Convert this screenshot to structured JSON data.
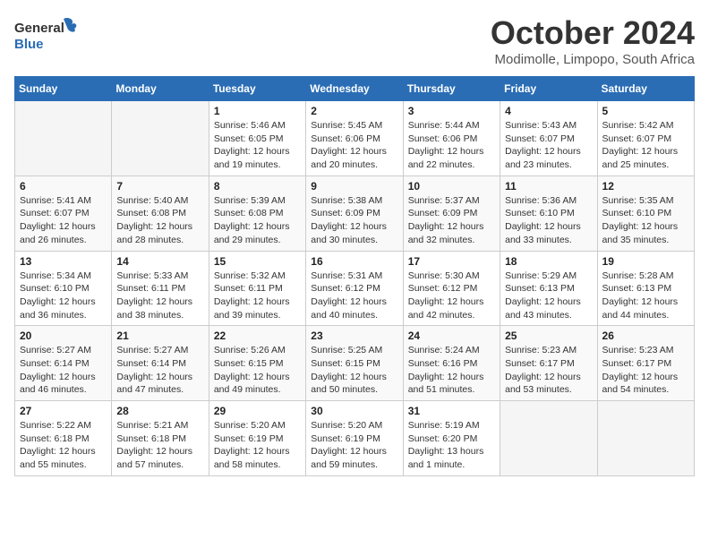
{
  "header": {
    "logo_general": "General",
    "logo_blue": "Blue",
    "month_title": "October 2024",
    "location": "Modimolle, Limpopo, South Africa"
  },
  "weekdays": [
    "Sunday",
    "Monday",
    "Tuesday",
    "Wednesday",
    "Thursday",
    "Friday",
    "Saturday"
  ],
  "weeks": [
    [
      {
        "day": "",
        "info": ""
      },
      {
        "day": "",
        "info": ""
      },
      {
        "day": "1",
        "info": "Sunrise: 5:46 AM\nSunset: 6:05 PM\nDaylight: 12 hours and 19 minutes."
      },
      {
        "day": "2",
        "info": "Sunrise: 5:45 AM\nSunset: 6:06 PM\nDaylight: 12 hours and 20 minutes."
      },
      {
        "day": "3",
        "info": "Sunrise: 5:44 AM\nSunset: 6:06 PM\nDaylight: 12 hours and 22 minutes."
      },
      {
        "day": "4",
        "info": "Sunrise: 5:43 AM\nSunset: 6:07 PM\nDaylight: 12 hours and 23 minutes."
      },
      {
        "day": "5",
        "info": "Sunrise: 5:42 AM\nSunset: 6:07 PM\nDaylight: 12 hours and 25 minutes."
      }
    ],
    [
      {
        "day": "6",
        "info": "Sunrise: 5:41 AM\nSunset: 6:07 PM\nDaylight: 12 hours and 26 minutes."
      },
      {
        "day": "7",
        "info": "Sunrise: 5:40 AM\nSunset: 6:08 PM\nDaylight: 12 hours and 28 minutes."
      },
      {
        "day": "8",
        "info": "Sunrise: 5:39 AM\nSunset: 6:08 PM\nDaylight: 12 hours and 29 minutes."
      },
      {
        "day": "9",
        "info": "Sunrise: 5:38 AM\nSunset: 6:09 PM\nDaylight: 12 hours and 30 minutes."
      },
      {
        "day": "10",
        "info": "Sunrise: 5:37 AM\nSunset: 6:09 PM\nDaylight: 12 hours and 32 minutes."
      },
      {
        "day": "11",
        "info": "Sunrise: 5:36 AM\nSunset: 6:10 PM\nDaylight: 12 hours and 33 minutes."
      },
      {
        "day": "12",
        "info": "Sunrise: 5:35 AM\nSunset: 6:10 PM\nDaylight: 12 hours and 35 minutes."
      }
    ],
    [
      {
        "day": "13",
        "info": "Sunrise: 5:34 AM\nSunset: 6:10 PM\nDaylight: 12 hours and 36 minutes."
      },
      {
        "day": "14",
        "info": "Sunrise: 5:33 AM\nSunset: 6:11 PM\nDaylight: 12 hours and 38 minutes."
      },
      {
        "day": "15",
        "info": "Sunrise: 5:32 AM\nSunset: 6:11 PM\nDaylight: 12 hours and 39 minutes."
      },
      {
        "day": "16",
        "info": "Sunrise: 5:31 AM\nSunset: 6:12 PM\nDaylight: 12 hours and 40 minutes."
      },
      {
        "day": "17",
        "info": "Sunrise: 5:30 AM\nSunset: 6:12 PM\nDaylight: 12 hours and 42 minutes."
      },
      {
        "day": "18",
        "info": "Sunrise: 5:29 AM\nSunset: 6:13 PM\nDaylight: 12 hours and 43 minutes."
      },
      {
        "day": "19",
        "info": "Sunrise: 5:28 AM\nSunset: 6:13 PM\nDaylight: 12 hours and 44 minutes."
      }
    ],
    [
      {
        "day": "20",
        "info": "Sunrise: 5:27 AM\nSunset: 6:14 PM\nDaylight: 12 hours and 46 minutes."
      },
      {
        "day": "21",
        "info": "Sunrise: 5:27 AM\nSunset: 6:14 PM\nDaylight: 12 hours and 47 minutes."
      },
      {
        "day": "22",
        "info": "Sunrise: 5:26 AM\nSunset: 6:15 PM\nDaylight: 12 hours and 49 minutes."
      },
      {
        "day": "23",
        "info": "Sunrise: 5:25 AM\nSunset: 6:15 PM\nDaylight: 12 hours and 50 minutes."
      },
      {
        "day": "24",
        "info": "Sunrise: 5:24 AM\nSunset: 6:16 PM\nDaylight: 12 hours and 51 minutes."
      },
      {
        "day": "25",
        "info": "Sunrise: 5:23 AM\nSunset: 6:17 PM\nDaylight: 12 hours and 53 minutes."
      },
      {
        "day": "26",
        "info": "Sunrise: 5:23 AM\nSunset: 6:17 PM\nDaylight: 12 hours and 54 minutes."
      }
    ],
    [
      {
        "day": "27",
        "info": "Sunrise: 5:22 AM\nSunset: 6:18 PM\nDaylight: 12 hours and 55 minutes."
      },
      {
        "day": "28",
        "info": "Sunrise: 5:21 AM\nSunset: 6:18 PM\nDaylight: 12 hours and 57 minutes."
      },
      {
        "day": "29",
        "info": "Sunrise: 5:20 AM\nSunset: 6:19 PM\nDaylight: 12 hours and 58 minutes."
      },
      {
        "day": "30",
        "info": "Sunrise: 5:20 AM\nSunset: 6:19 PM\nDaylight: 12 hours and 59 minutes."
      },
      {
        "day": "31",
        "info": "Sunrise: 5:19 AM\nSunset: 6:20 PM\nDaylight: 13 hours and 1 minute."
      },
      {
        "day": "",
        "info": ""
      },
      {
        "day": "",
        "info": ""
      }
    ]
  ]
}
